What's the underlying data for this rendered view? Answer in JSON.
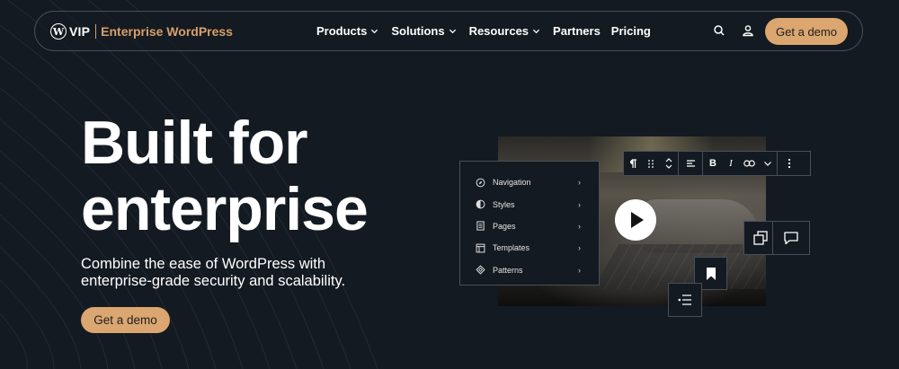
{
  "brand": {
    "mark": "W",
    "vip": "VIP",
    "product": "Enterprise WordPress"
  },
  "nav": {
    "items": [
      {
        "label": "Products",
        "has_dropdown": true
      },
      {
        "label": "Solutions",
        "has_dropdown": true
      },
      {
        "label": "Resources",
        "has_dropdown": true
      },
      {
        "label": "Partners",
        "has_dropdown": false
      },
      {
        "label": "Pricing",
        "has_dropdown": false
      }
    ],
    "search_icon": "search-icon",
    "account_icon": "user-icon",
    "cta": "Get a demo"
  },
  "hero": {
    "title_line1": "Built for",
    "title_line2": "enterprise",
    "subtitle_line1": "Combine the ease of WordPress with",
    "subtitle_line2": "enterprise-grade security and scalability.",
    "cta": "Get a demo"
  },
  "editor_panel": {
    "items": [
      {
        "label": "Navigation",
        "icon": "compass-icon"
      },
      {
        "label": "Styles",
        "icon": "half-circle-icon"
      },
      {
        "label": "Pages",
        "icon": "page-icon"
      },
      {
        "label": "Templates",
        "icon": "layout-icon"
      },
      {
        "label": "Patterns",
        "icon": "diamond-icon"
      }
    ],
    "chevron": "›"
  },
  "colors": {
    "background": "#141a22",
    "accent": "#dba66f",
    "brand_text": "#d8a06a",
    "border": "#4a4f57"
  }
}
